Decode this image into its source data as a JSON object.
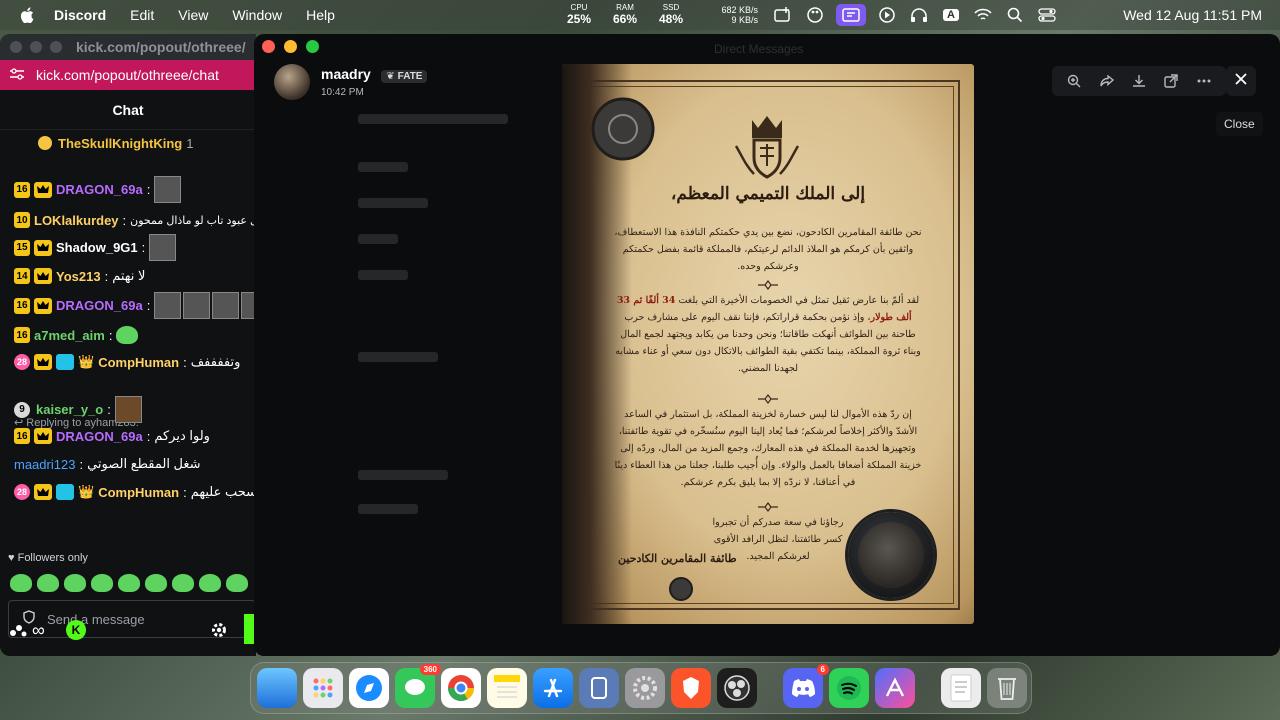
{
  "menubar": {
    "app_name": "Discord",
    "menus": [
      "Edit",
      "View",
      "Window",
      "Help"
    ],
    "stats": [
      {
        "label": "CPU",
        "value": "25%"
      },
      {
        "label": "RAM",
        "value": "66%"
      },
      {
        "label": "SSD",
        "value": "48%"
      }
    ],
    "net_up": "682 KB/s",
    "net_down": "9 KB/s",
    "keyboard_input": "A",
    "clock": "Wed 12 Aug  11:51 PM"
  },
  "kick": {
    "window_url": "kick.com/popout/othreee/",
    "url": "kick.com/popout/othreee/chat",
    "chat_title": "Chat",
    "pinned_user": "TheSkullKnightKing",
    "pinned_count": "1",
    "messages": [
      {
        "badge": "16",
        "user": "DRAGON_69a",
        "color": "#b86cff",
        "text": ""
      },
      {
        "badge": "10",
        "user": "LOKlalkurdey",
        "color": "#ffd166",
        "text": "هل عبود تاب لو ماذال ممحون"
      },
      {
        "badge": "15",
        "user": "Shadow_9G1",
        "color": "#ffffff",
        "text": ""
      },
      {
        "badge": "14",
        "user": "Yos213",
        "color": "#ffd166",
        "text": "لا نهتم"
      },
      {
        "badge": "16",
        "user": "DRAGON_69a",
        "color": "#b86cff",
        "text": ""
      },
      {
        "badge": "16",
        "user": "a7med_aim",
        "color": "#6dd36d",
        "text": ""
      },
      {
        "badge": "28",
        "user": "CompHuman",
        "color": "#ffd166",
        "text": "وتففففف"
      },
      {
        "badge": "9",
        "user": "kaiser_y_o",
        "color": "#6dd36d",
        "text": ""
      },
      {
        "badge": "16",
        "user": "DRAGON_69a",
        "color": "#b86cff",
        "text": "ولوا ديركم"
      },
      {
        "badge": "",
        "user": "maadri123",
        "color": "#4da3ff",
        "text": "شغل المقطع الصوتي"
      },
      {
        "badge": "28",
        "user": "CompHuman",
        "color": "#ffd166",
        "text": "اسحب عليهم"
      }
    ],
    "reply_note": "Replying to ayham283:",
    "followers_only": "Followers only",
    "send_placeholder": "Send a message",
    "infinity": "∞"
  },
  "discord": {
    "bg_title": "Direct Messages",
    "author": "maadry",
    "tag": "FATE",
    "time": "10:42 PM",
    "tooltip": "Close"
  },
  "letter": {
    "heading": "إلى الملك التميمي المعظم،",
    "para1": "نحن طائفة المقامرين الكادحون، نضع بين يدي حكمتكم النافذة هذا الاستعطاف، واثقين بأن كرمكم هو الملاذ الدائم لرعيتكم، فالمملكة قائمة بفضل حكمتكم وعرشكم وحده.",
    "para2_a": "لقد ألمّ بنا عارض ثقيل تمثل في الخصومات الأخيرة التي بلغت",
    "para2_red": "34 ألفًا ثم 33 ألف طولار",
    "para2_b": "، وإذ نؤمن بحكمة قراراتكم، فإننا نقف اليوم على مشارف حرب طاحنة بين الطوائف أنهكت طاقاتنا؛ ونحن وحدنا من يكابد ويجتهد لجمع المال وبناء ثروة المملكة، بينما تكتفي بقية الطوائف بالاتكال دون سعي أو عناء مشابه لجهدنا المضني.",
    "para3": "إن ردّ هذه الأموال لنا ليس خسارة لخزينة المملكة، بل استثمار في الساعد الأشدّ والأكثر إخلاصاً لعرشكم؛ فما يُعاد إلينا اليوم سنُسخّره في تقوية طائفتنا، وتجهيزها لخدمة المملكة في هذه المعارك، وجمع المزيد من المال، وردّه إلى خزينة المملكة أضعافا بالعمل والولاء. وإن أُجيب طلبنا، جعلنا من هذا العطاء دينًا في أعناقنا، لا نردّه إلا بما يليق بكرم عرشكم.",
    "para4": "رجاؤنا في سعة صدركم أن تجبروا كسر طائفتنا، لتظل الرافد الأقوى لعرشكم المجيد.",
    "signature": "طائفة المقامرين الكادحين"
  },
  "dock": {
    "messages_badge": "360",
    "discord_badge": "6"
  }
}
